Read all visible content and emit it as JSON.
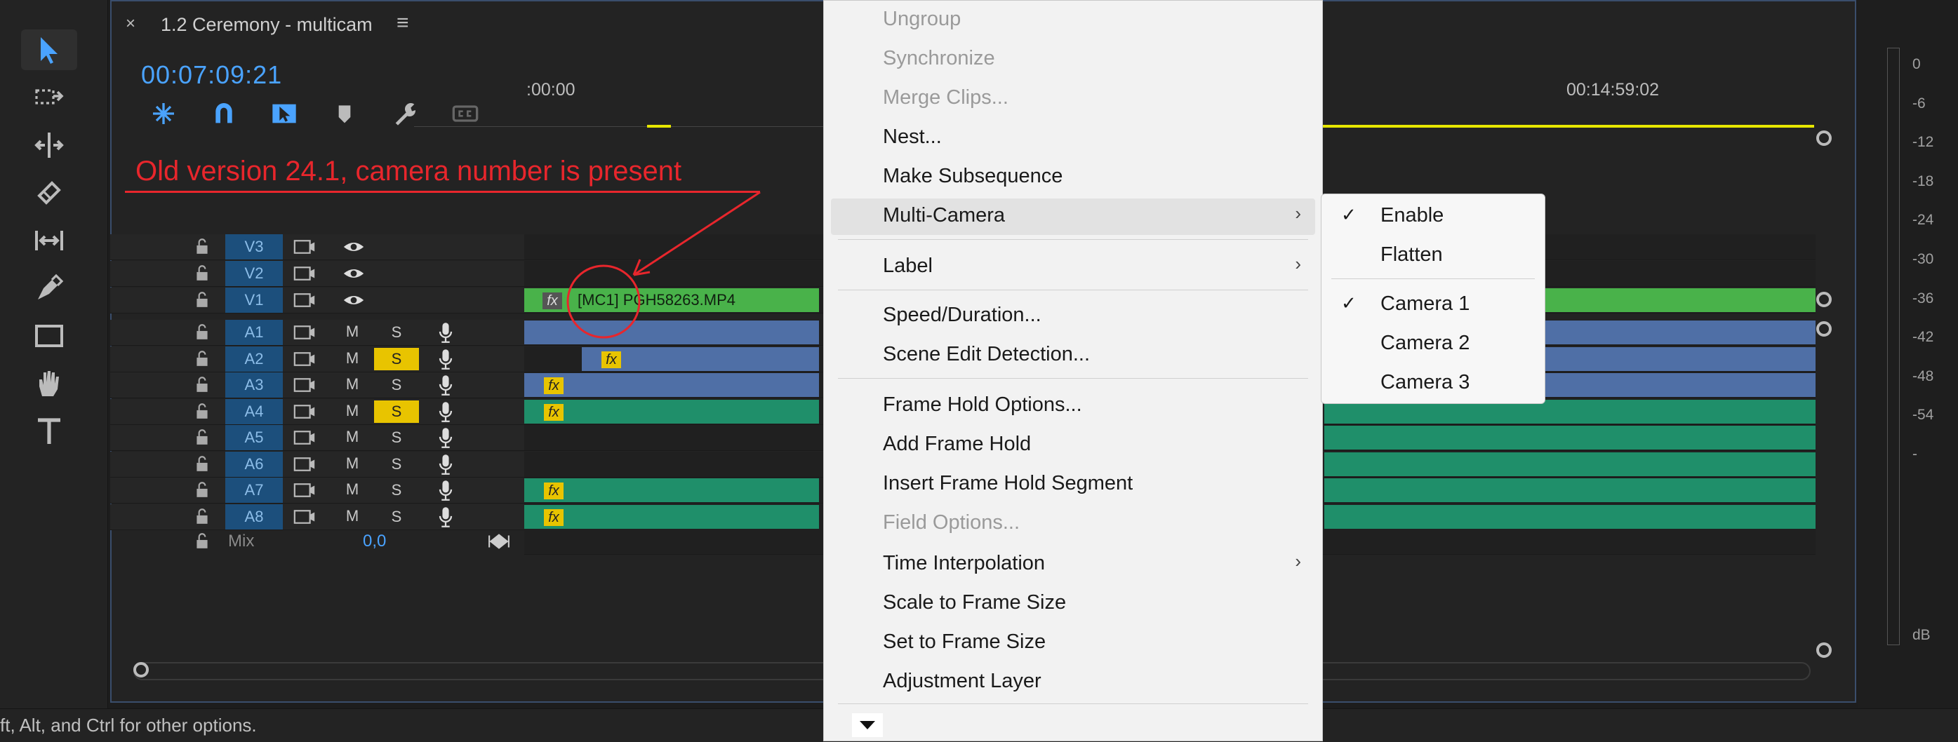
{
  "sequence": {
    "tab_close": "×",
    "tab_title": "1.2 Ceremony - multicam",
    "tab_menu": "≡",
    "timecode": "00:07:09:21"
  },
  "ruler": {
    "start_label": ":00:00",
    "mid_label": "00:14:59:02"
  },
  "annotation": {
    "text": "Old version 24.1,   camera number is present",
    "color": "#e8262c"
  },
  "tracks": {
    "video": [
      {
        "name": "V3"
      },
      {
        "name": "V2"
      },
      {
        "name": "V1"
      }
    ],
    "audio": [
      {
        "name": "A1",
        "m": "M",
        "s": "S",
        "solo": false
      },
      {
        "name": "A2",
        "m": "M",
        "s": "S",
        "solo": true
      },
      {
        "name": "A3",
        "m": "M",
        "s": "S",
        "solo": false
      },
      {
        "name": "A4",
        "m": "M",
        "s": "S",
        "solo": true
      },
      {
        "name": "A5",
        "m": "M",
        "s": "S",
        "solo": false
      },
      {
        "name": "A6",
        "m": "M",
        "s": "S",
        "solo": false
      },
      {
        "name": "A7",
        "m": "M",
        "s": "S",
        "solo": false
      },
      {
        "name": "A8",
        "m": "M",
        "s": "S",
        "solo": false
      }
    ],
    "mix_label": "Mix",
    "mix_value": "0,0"
  },
  "clips": {
    "v1_label": "[MC1] PGH58263.MP4",
    "fx": "fx"
  },
  "context_menu": {
    "items": [
      {
        "label": "Ungroup",
        "disabled": true
      },
      {
        "label": "Synchronize",
        "disabled": true
      },
      {
        "label": "Merge Clips...",
        "disabled": true
      },
      {
        "label": "Nest...",
        "disabled": false
      },
      {
        "label": "Make Subsequence",
        "disabled": false
      },
      {
        "label": "Multi-Camera",
        "disabled": false,
        "submenu": true
      },
      {
        "label": "Label",
        "disabled": false,
        "submenu": true
      },
      {
        "label": "Speed/Duration...",
        "disabled": false
      },
      {
        "label": "Scene Edit Detection...",
        "disabled": false
      },
      {
        "label": "Frame Hold Options...",
        "disabled": false
      },
      {
        "label": "Add Frame Hold",
        "disabled": false
      },
      {
        "label": "Insert Frame Hold Segment",
        "disabled": false
      },
      {
        "label": "Field Options...",
        "disabled": true
      },
      {
        "label": "Time Interpolation",
        "disabled": false,
        "submenu": true
      },
      {
        "label": "Scale to Frame Size",
        "disabled": false
      },
      {
        "label": "Set to Frame Size",
        "disabled": false
      },
      {
        "label": "Adjustment Layer",
        "disabled": false
      }
    ],
    "arrow": "›"
  },
  "multicam_submenu": {
    "check": "✓",
    "items": [
      {
        "label": "Enable",
        "checked": true
      },
      {
        "label": "Flatten",
        "checked": false
      },
      {
        "label": "Camera 1",
        "checked": true
      },
      {
        "label": "Camera 2",
        "checked": false
      },
      {
        "label": "Camera 3",
        "checked": false
      }
    ]
  },
  "meter": {
    "db_labels": [
      "0",
      "-6",
      "-12",
      "-18",
      "-24",
      "-30",
      "-36",
      "-42",
      "-48",
      "-54",
      "-"
    ],
    "unit": "dB"
  },
  "status": {
    "text": "ft, Alt, and Ctrl for other options."
  },
  "icons": [
    "selection-icon",
    "track-select-icon",
    "ripple-edit-icon",
    "razor-icon",
    "slip-icon",
    "pen-icon",
    "rectangle-icon",
    "hand-icon",
    "type-icon"
  ]
}
